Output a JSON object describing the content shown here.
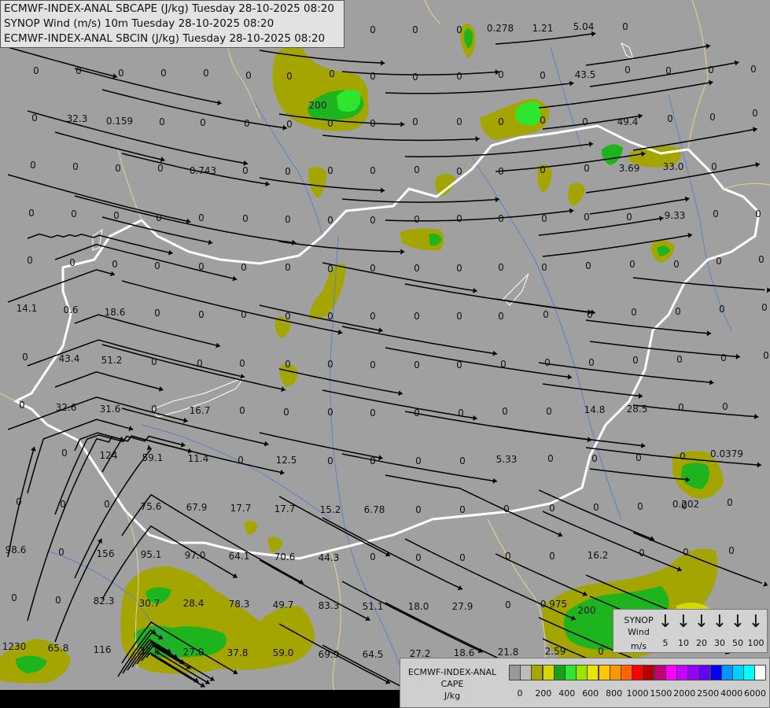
{
  "header": {
    "lines": [
      "ECMWF-INDEX-ANAL SBCAPE (J/kg) Tuesday 28-10-2025 08:20",
      "SYNOP Wind (m/s) 10m Tuesday 28-10-2025 08:20",
      "ECMWF-INDEX-ANAL SBCIN (J/kg) Tuesday 28-10-2025 08:20"
    ]
  },
  "colors": {
    "background": "#a0a0a0",
    "cape_low": "#a5a500",
    "cape_200": "#1eb41e",
    "cape_400": "#2ee62e",
    "border": "#ffffff",
    "rivers": "#5a82c8",
    "streamlines": "#000000"
  },
  "wind_legend": {
    "title_lines": [
      "SYNOP",
      "Wind",
      "m/s"
    ],
    "speeds": [
      "5",
      "10",
      "20",
      "30",
      "50",
      "100"
    ],
    "arrow_glyph": "↓"
  },
  "cape_legend": {
    "title_lines": [
      "ECMWF-INDEX-ANAL",
      "CAPE",
      "J/kg"
    ],
    "colors": [
      "#9a9a9a",
      "#bcbcbc",
      "#a6a600",
      "#d6d600",
      "#1aa01a",
      "#2ee62e",
      "#9be600",
      "#e6e600",
      "#ffc800",
      "#ff9600",
      "#ff6400",
      "#ff0000",
      "#b40000",
      "#c80078",
      "#ff00ff",
      "#c800ff",
      "#9600ff",
      "#6400ff",
      "#0000ff",
      "#0096ff",
      "#00d2ff",
      "#00ffff",
      "#ffffff"
    ],
    "ticks": [
      "0",
      "200",
      "400",
      "600",
      "800",
      "1000",
      "1500",
      "2000",
      "2500",
      "4000",
      "6000"
    ]
  },
  "value_labels": [
    [
      "0",
      474,
      42
    ],
    [
      "0",
      528,
      42
    ],
    [
      "0",
      584,
      42
    ],
    [
      "0.278",
      636,
      40
    ],
    [
      "1.21",
      690,
      40
    ],
    [
      "5.04",
      742,
      38
    ],
    [
      "0",
      795,
      38
    ],
    [
      "0",
      46,
      94
    ],
    [
      "0",
      100,
      94
    ],
    [
      "0",
      154,
      97
    ],
    [
      "0",
      208,
      97
    ],
    [
      "0",
      262,
      97
    ],
    [
      "0",
      316,
      100
    ],
    [
      "0",
      368,
      101
    ],
    [
      "0",
      422,
      98
    ],
    [
      "0",
      474,
      101
    ],
    [
      "0",
      528,
      102
    ],
    [
      "0",
      584,
      101
    ],
    [
      "0",
      637,
      99
    ],
    [
      "0",
      690,
      100
    ],
    [
      "43.5",
      744,
      99
    ],
    [
      "0",
      798,
      93
    ],
    [
      "0",
      850,
      94
    ],
    [
      "0",
      904,
      93
    ],
    [
      "0",
      958,
      92
    ],
    [
      "0",
      44,
      154
    ],
    [
      "32.3",
      98,
      155
    ],
    [
      "0.159",
      152,
      158
    ],
    [
      "0",
      206,
      159
    ],
    [
      "0",
      258,
      160
    ],
    [
      "0",
      314,
      161
    ],
    [
      "0",
      368,
      162
    ],
    [
      "200",
      404,
      138
    ],
    [
      "0",
      420,
      161
    ],
    [
      "0",
      474,
      161
    ],
    [
      "0",
      528,
      159
    ],
    [
      "0",
      584,
      159
    ],
    [
      "0",
      637,
      159
    ],
    [
      "0",
      690,
      157
    ],
    [
      "0",
      744,
      159
    ],
    [
      "49.4",
      798,
      159
    ],
    [
      "0",
      852,
      155
    ],
    [
      "0",
      906,
      153
    ],
    [
      "0",
      960,
      148
    ],
    [
      "0",
      42,
      214
    ],
    [
      "0",
      96,
      216
    ],
    [
      "0",
      150,
      218
    ],
    [
      "0",
      204,
      218
    ],
    [
      "0.743",
      258,
      221
    ],
    [
      "0",
      312,
      221
    ],
    [
      "0",
      366,
      222
    ],
    [
      "0",
      420,
      221
    ],
    [
      "0",
      474,
      221
    ],
    [
      "0",
      530,
      220
    ],
    [
      "0",
      584,
      222
    ],
    [
      "0",
      637,
      222
    ],
    [
      "0",
      690,
      220
    ],
    [
      "0",
      746,
      218
    ],
    [
      "3.69",
      800,
      218
    ],
    [
      "33.0",
      856,
      216
    ],
    [
      "0",
      908,
      216
    ],
    [
      "0",
      40,
      275
    ],
    [
      "0",
      94,
      276
    ],
    [
      "0",
      148,
      278
    ],
    [
      "0",
      202,
      281
    ],
    [
      "0",
      256,
      281
    ],
    [
      "0",
      312,
      282
    ],
    [
      "0",
      366,
      283
    ],
    [
      "0",
      420,
      284
    ],
    [
      "0",
      474,
      284
    ],
    [
      "0",
      530,
      283
    ],
    [
      "0",
      584,
      282
    ],
    [
      "0",
      637,
      282
    ],
    [
      "0",
      692,
      282
    ],
    [
      "0",
      746,
      280
    ],
    [
      "0",
      800,
      280
    ],
    [
      "9.33",
      858,
      278
    ],
    [
      "0",
      910,
      276
    ],
    [
      "0",
      964,
      276
    ],
    [
      "0",
      38,
      335
    ],
    [
      "0",
      92,
      338
    ],
    [
      "0",
      146,
      340
    ],
    [
      "0",
      200,
      342
    ],
    [
      "0",
      256,
      343
    ],
    [
      "0",
      310,
      344
    ],
    [
      "0",
      366,
      344
    ],
    [
      "0",
      420,
      346
    ],
    [
      "0",
      474,
      345
    ],
    [
      "0",
      530,
      345
    ],
    [
      "0",
      584,
      345
    ],
    [
      "0",
      637,
      344
    ],
    [
      "0",
      692,
      344
    ],
    [
      "0",
      748,
      342
    ],
    [
      "0",
      804,
      340
    ],
    [
      "0",
      860,
      340
    ],
    [
      "0",
      914,
      336
    ],
    [
      "0",
      968,
      334
    ],
    [
      "14.1",
      34,
      396
    ],
    [
      "0.6",
      90,
      398
    ],
    [
      "18.6",
      146,
      401
    ],
    [
      "0",
      200,
      402
    ],
    [
      "0",
      256,
      404
    ],
    [
      "0",
      310,
      404
    ],
    [
      "0",
      366,
      406
    ],
    [
      "0",
      420,
      406
    ],
    [
      "0",
      474,
      406
    ],
    [
      "0",
      530,
      406
    ],
    [
      "0",
      584,
      406
    ],
    [
      "0",
      637,
      406
    ],
    [
      "0",
      694,
      404
    ],
    [
      "0",
      750,
      404
    ],
    [
      "0",
      806,
      401
    ],
    [
      "0",
      862,
      400
    ],
    [
      "0",
      918,
      397
    ],
    [
      "0",
      972,
      395
    ],
    [
      "0",
      32,
      458
    ],
    [
      "43.4",
      88,
      460
    ],
    [
      "51.2",
      142,
      462
    ],
    [
      "0",
      196,
      464
    ],
    [
      "0",
      254,
      466
    ],
    [
      "0",
      308,
      466
    ],
    [
      "0",
      366,
      467
    ],
    [
      "0",
      420,
      467
    ],
    [
      "0",
      474,
      468
    ],
    [
      "0",
      530,
      468
    ],
    [
      "0",
      584,
      468
    ],
    [
      "0",
      640,
      467
    ],
    [
      "0",
      696,
      465
    ],
    [
      "0",
      752,
      465
    ],
    [
      "0",
      808,
      462
    ],
    [
      "0",
      864,
      461
    ],
    [
      "0",
      920,
      459
    ],
    [
      "0",
      974,
      456
    ],
    [
      "0",
      28,
      519
    ],
    [
      "32.6",
      84,
      522
    ],
    [
      "31.6",
      140,
      524
    ],
    [
      "0",
      196,
      524
    ],
    [
      "16.7",
      254,
      526
    ],
    [
      "0",
      308,
      526
    ],
    [
      "0",
      364,
      528
    ],
    [
      "0",
      420,
      528
    ],
    [
      "0",
      474,
      529
    ],
    [
      "0",
      530,
      529
    ],
    [
      "0",
      586,
      529
    ],
    [
      "0",
      642,
      527
    ],
    [
      "0",
      698,
      527
    ],
    [
      "14.8",
      756,
      525
    ],
    [
      "28.5",
      810,
      524
    ],
    [
      "0",
      866,
      522
    ],
    [
      "0",
      922,
      521
    ],
    [
      "0",
      82,
      580
    ],
    [
      "124",
      138,
      583
    ],
    [
      "59.1",
      194,
      586
    ],
    [
      "11.4",
      252,
      587
    ],
    [
      "0",
      306,
      589
    ],
    [
      "12.5",
      364,
      589
    ],
    [
      "0",
      420,
      590
    ],
    [
      "0",
      474,
      590
    ],
    [
      "0",
      532,
      590
    ],
    [
      "0",
      588,
      590
    ],
    [
      "5.33",
      644,
      588
    ],
    [
      "0",
      700,
      587
    ],
    [
      "0",
      756,
      587
    ],
    [
      "0",
      812,
      586
    ],
    [
      "0",
      868,
      584
    ],
    [
      "0.0379",
      924,
      581
    ],
    [
      "0",
      24,
      642
    ],
    [
      "0",
      80,
      645
    ],
    [
      "0",
      136,
      645
    ],
    [
      "75.6",
      192,
      648
    ],
    [
      "67.9",
      250,
      649
    ],
    [
      "17.7",
      306,
      650
    ],
    [
      "17.7",
      362,
      651
    ],
    [
      "15.2",
      420,
      652
    ],
    [
      "6.78",
      476,
      652
    ],
    [
      "0",
      532,
      652
    ],
    [
      "0",
      588,
      652
    ],
    [
      "0",
      644,
      651
    ],
    [
      "0",
      702,
      650
    ],
    [
      "0",
      758,
      649
    ],
    [
      "0",
      814,
      648
    ],
    [
      "0",
      870,
      647
    ],
    [
      "0.202",
      872,
      645
    ],
    [
      "0",
      928,
      643
    ],
    [
      "98.6",
      20,
      703
    ],
    [
      "0",
      78,
      706
    ],
    [
      "156",
      134,
      708
    ],
    [
      "95.1",
      192,
      709
    ],
    [
      "97.0",
      248,
      710
    ],
    [
      "64.1",
      304,
      711
    ],
    [
      "70.6",
      362,
      712
    ],
    [
      "44.3",
      418,
      713
    ],
    [
      "0",
      474,
      712
    ],
    [
      "0",
      532,
      713
    ],
    [
      "0",
      588,
      713
    ],
    [
      "0",
      646,
      711
    ],
    [
      "0",
      702,
      711
    ],
    [
      "16.2",
      760,
      710
    ],
    [
      "0",
      816,
      707
    ],
    [
      "0",
      872,
      706
    ],
    [
      "0",
      930,
      704
    ],
    [
      "0",
      18,
      764
    ],
    [
      "0",
      74,
      767
    ],
    [
      "82.3",
      132,
      768
    ],
    [
      "30.7",
      190,
      771
    ],
    [
      "28.4",
      246,
      771
    ],
    [
      "78.3",
      304,
      772
    ],
    [
      "49.7",
      360,
      773
    ],
    [
      "83.3",
      418,
      774
    ],
    [
      "51.1",
      474,
      775
    ],
    [
      "18.0",
      532,
      775
    ],
    [
      "27.9",
      588,
      775
    ],
    [
      "0",
      646,
      773
    ],
    [
      "0.975",
      704,
      772
    ],
    [
      "200",
      746,
      780
    ],
    [
      "1230",
      18,
      826
    ],
    [
      "65.8",
      74,
      828
    ],
    [
      "116",
      130,
      830
    ],
    [
      "32.8",
      190,
      832
    ],
    [
      "27.0",
      246,
      833
    ],
    [
      "37.8",
      302,
      834
    ],
    [
      "59.0",
      360,
      834
    ],
    [
      "69.9",
      418,
      836
    ],
    [
      "64.5",
      474,
      836
    ],
    [
      "27.2",
      534,
      835
    ],
    [
      "18.6",
      590,
      834
    ],
    [
      "21.8",
      646,
      833
    ],
    [
      "2.59",
      706,
      832
    ],
    [
      "0",
      764,
      832
    ]
  ]
}
